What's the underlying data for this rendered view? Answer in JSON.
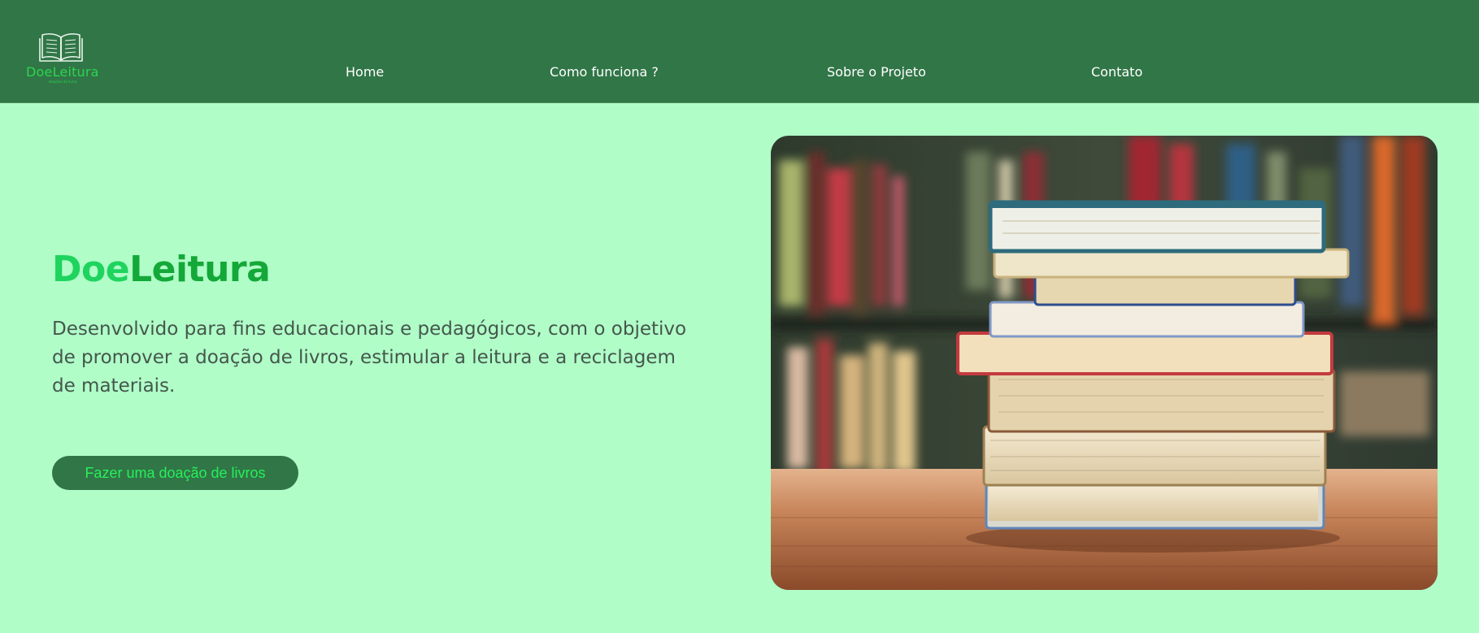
{
  "brand": {
    "logo_doe": "Doe",
    "logo_leitura": "Leitura",
    "logo_tagline": "doações de livros"
  },
  "nav": {
    "items": [
      {
        "label": "Home"
      },
      {
        "label": "Como funciona ?"
      },
      {
        "label": "Sobre o Projeto"
      },
      {
        "label": "Contato"
      }
    ]
  },
  "hero": {
    "title_doe": "Doe",
    "title_leitura": "Leitura",
    "description": "Desenvolvido para fins educacionais e pedagógicos, com o objetivo de promover a doação de livros, estimular a leitura e a reciclagem de materiais.",
    "cta_label": "Fazer uma doação de livros",
    "image_alt": "pilha de livros sobre mesa de madeira em frente a estante"
  },
  "colors": {
    "nav_bg": "#317647",
    "page_bg": "#b0fdc8",
    "accent_light": "#1ed45e",
    "accent_dark": "#14a838",
    "button_bg": "#317647",
    "button_text": "#26f05a",
    "body_text": "#45574c"
  },
  "icons": {
    "logo_icon": "open-book-icon"
  }
}
